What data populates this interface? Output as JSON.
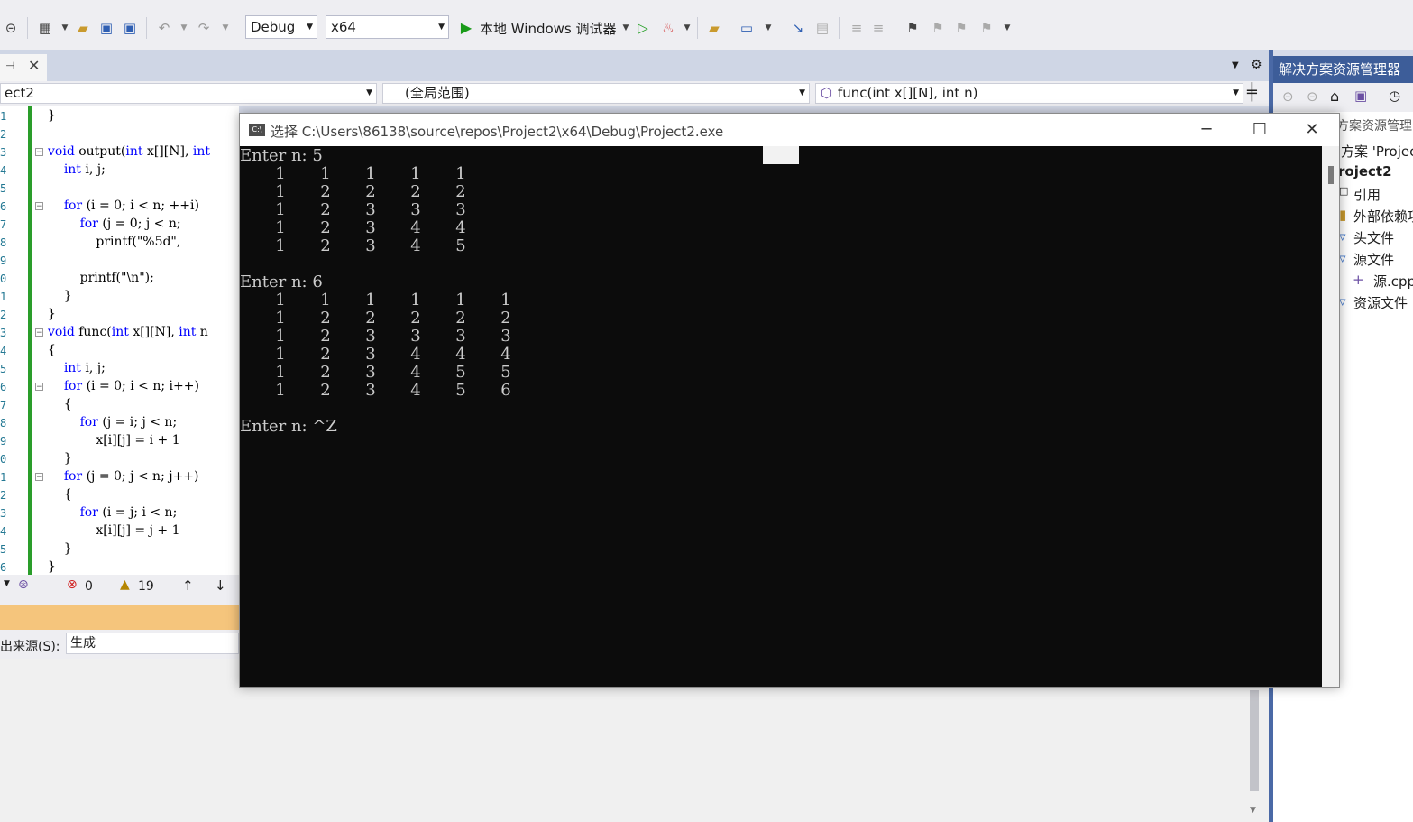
{
  "toolbar": {
    "config": "Debug",
    "platform": "x64",
    "run_label": "本地 Windows 调试器"
  },
  "navbar": {
    "project": "ect2",
    "scope": "(全局范围)",
    "member": "func(int x[][N], int n)"
  },
  "editor": {
    "line_numbers": [
      "1",
      "2",
      "3",
      "4",
      "5",
      "6",
      "7",
      "8",
      "9",
      "0",
      "1",
      "2",
      "3",
      "4",
      "5",
      "6",
      "7",
      "8",
      "9",
      "0",
      "1",
      "2",
      "3",
      "4",
      "5",
      "6"
    ],
    "lines": [
      "}",
      "",
      "void output(int x[][N], int",
      "    int i, j;",
      "",
      "    for (i = 0; i < n; ++i)",
      "        for (j = 0; j < n;",
      "            printf(\"%5d\",",
      "",
      "        printf(\"\\n\");",
      "    }",
      "}",
      "void func(int x[][N], int n",
      "{",
      "    int i, j;",
      "    for (i = 0; i < n; i++)",
      "    {",
      "        for (j = i; j < n;",
      "            x[i][j] = i + 1",
      "    }",
      "    for (j = 0; j < n; j++)",
      "    {",
      "        for (i = j; i < n;",
      "            x[i][j] = j + 1",
      "    }",
      "}"
    ]
  },
  "status": {
    "errors": "0",
    "warnings": "19"
  },
  "output": {
    "source_label": "出来源(S):",
    "source_value": "生成"
  },
  "solution_explorer": {
    "title": "解决方案资源管理器",
    "search_hint": "方案资源管理",
    "solution": "方案 'Projec",
    "project": "roject2",
    "items": [
      "引用",
      "外部依赖项",
      "头文件",
      "源文件",
      "源.cpp",
      "资源文件"
    ]
  },
  "console": {
    "title": "选择 C:\\Users\\86138\\source\\repos\\Project2\\x64\\Debug\\Project2.exe",
    "icon_label": "C:\\",
    "prompt1": "Enter n: 5",
    "matrix1": [
      [
        1,
        1,
        1,
        1,
        1
      ],
      [
        1,
        2,
        2,
        2,
        2
      ],
      [
        1,
        2,
        3,
        3,
        3
      ],
      [
        1,
        2,
        3,
        4,
        4
      ],
      [
        1,
        2,
        3,
        4,
        5
      ]
    ],
    "prompt2": "Enter n: 6",
    "matrix2": [
      [
        1,
        1,
        1,
        1,
        1,
        1
      ],
      [
        1,
        2,
        2,
        2,
        2,
        2
      ],
      [
        1,
        2,
        3,
        3,
        3,
        3
      ],
      [
        1,
        2,
        3,
        4,
        4,
        4
      ],
      [
        1,
        2,
        3,
        4,
        5,
        5
      ],
      [
        1,
        2,
        3,
        4,
        5,
        6
      ]
    ],
    "prompt3": "Enter n: ^Z"
  }
}
